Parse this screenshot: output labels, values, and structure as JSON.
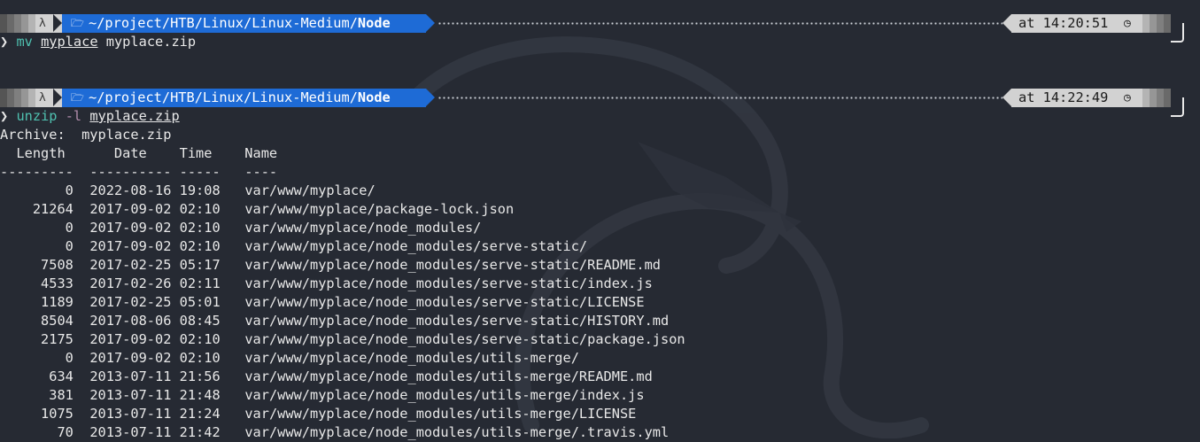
{
  "colors": {
    "background": "#262a33",
    "dir_segment": "#1e6bd6",
    "time_segment": "#d2d2d2",
    "command": "#4fc1b0",
    "flag": "#b48ead"
  },
  "prompts": [
    {
      "os_icon": "linux-penguin-icon",
      "folder_icon": "folder-open-icon",
      "path_prefix": "~/project/HTB/Linux/Linux-Medium/",
      "path_leaf": "Node",
      "time_label": "at 14:20:51",
      "clock_icon": "clock-icon"
    },
    {
      "os_icon": "linux-penguin-icon",
      "folder_icon": "folder-open-icon",
      "path_prefix": "~/project/HTB/Linux/Linux-Medium/",
      "path_leaf": "Node",
      "time_label": "at 14:22:49",
      "clock_icon": "clock-icon"
    }
  ],
  "commands": [
    {
      "chevron": "❯",
      "name": "mv",
      "flag": "",
      "arg1": "myplace",
      "arg2": "myplace.zip"
    },
    {
      "chevron": "❯",
      "name": "unzip",
      "flag": "-l",
      "arg1": "myplace.zip",
      "arg2": ""
    }
  ],
  "output": {
    "archive_line": "Archive:  myplace.zip",
    "header_line": "  Length      Date    Time    Name",
    "separator_line": "---------  ---------- -----   ----",
    "rows": [
      {
        "length": "0",
        "date": "2022-08-16",
        "time": "19:08",
        "name": "var/www/myplace/"
      },
      {
        "length": "21264",
        "date": "2017-09-02",
        "time": "02:10",
        "name": "var/www/myplace/package-lock.json"
      },
      {
        "length": "0",
        "date": "2017-09-02",
        "time": "02:10",
        "name": "var/www/myplace/node_modules/"
      },
      {
        "length": "0",
        "date": "2017-09-02",
        "time": "02:10",
        "name": "var/www/myplace/node_modules/serve-static/"
      },
      {
        "length": "7508",
        "date": "2017-02-25",
        "time": "05:17",
        "name": "var/www/myplace/node_modules/serve-static/README.md"
      },
      {
        "length": "4533",
        "date": "2017-02-26",
        "time": "02:11",
        "name": "var/www/myplace/node_modules/serve-static/index.js"
      },
      {
        "length": "1189",
        "date": "2017-02-25",
        "time": "05:01",
        "name": "var/www/myplace/node_modules/serve-static/LICENSE"
      },
      {
        "length": "8504",
        "date": "2017-08-06",
        "time": "08:45",
        "name": "var/www/myplace/node_modules/serve-static/HISTORY.md"
      },
      {
        "length": "2175",
        "date": "2017-09-02",
        "time": "02:10",
        "name": "var/www/myplace/node_modules/serve-static/package.json"
      },
      {
        "length": "0",
        "date": "2017-09-02",
        "time": "02:10",
        "name": "var/www/myplace/node_modules/utils-merge/"
      },
      {
        "length": "634",
        "date": "2013-07-11",
        "time": "21:56",
        "name": "var/www/myplace/node_modules/utils-merge/README.md"
      },
      {
        "length": "381",
        "date": "2013-07-11",
        "time": "21:48",
        "name": "var/www/myplace/node_modules/utils-merge/index.js"
      },
      {
        "length": "1075",
        "date": "2013-07-11",
        "time": "21:24",
        "name": "var/www/myplace/node_modules/utils-merge/LICENSE"
      },
      {
        "length": "70",
        "date": "2013-07-11",
        "time": "21:42",
        "name": "var/www/myplace/node_modules/utils-merge/.travis.yml"
      }
    ]
  }
}
